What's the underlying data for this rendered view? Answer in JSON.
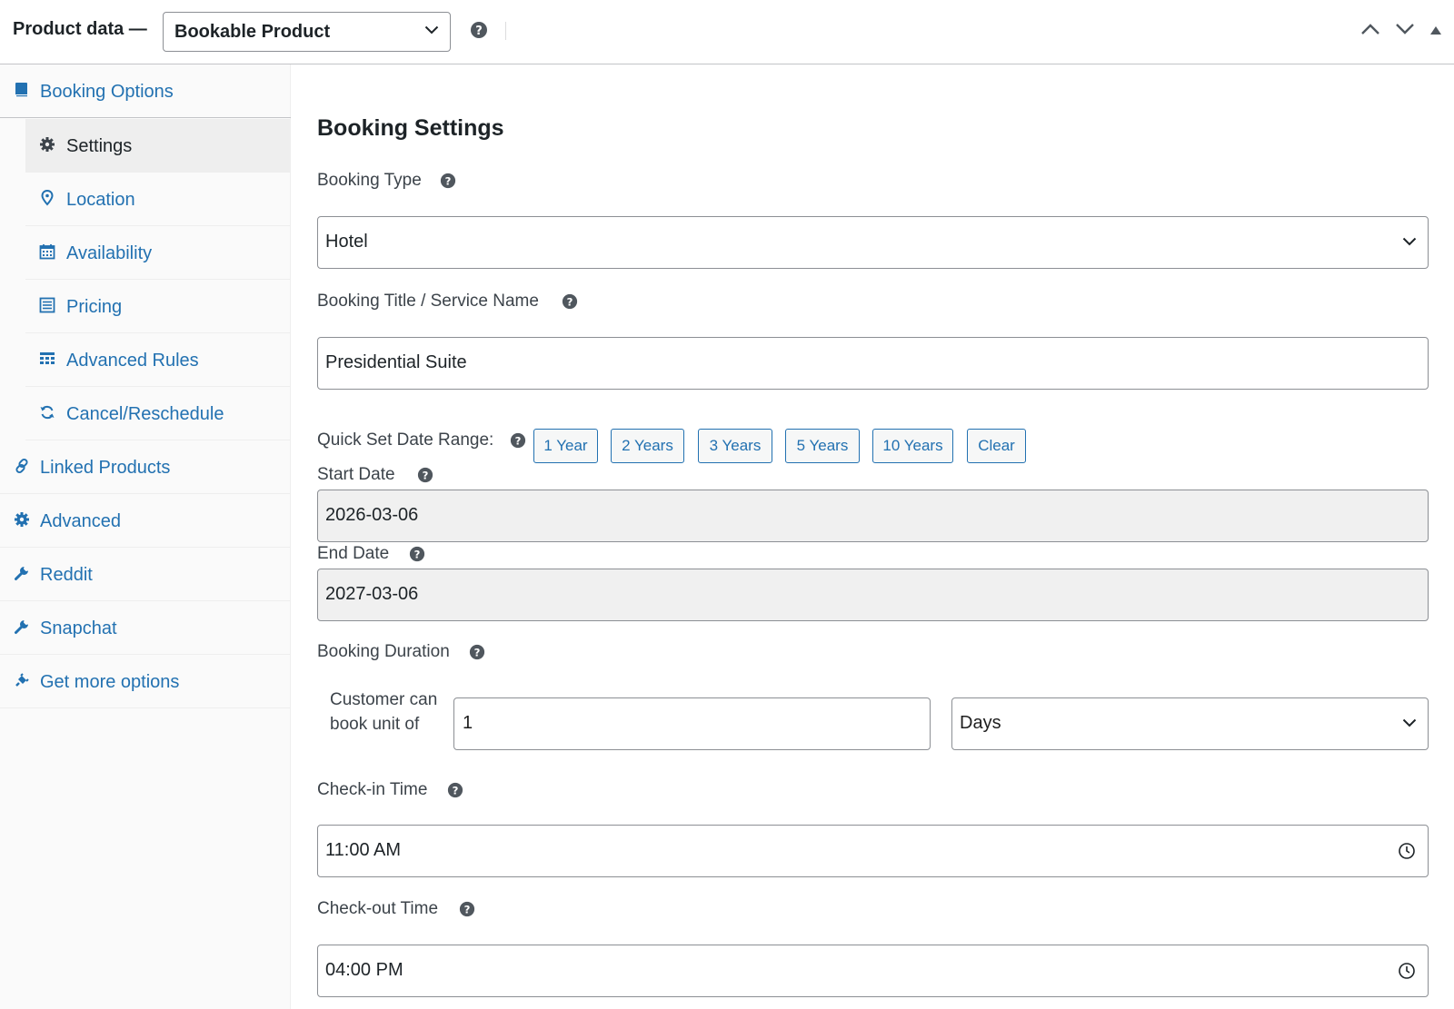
{
  "header": {
    "title": "Product data —",
    "product_type": "Bookable Product"
  },
  "sidebar": {
    "items": [
      {
        "label": "Booking Options",
        "icon": "book-icon"
      },
      {
        "label": "Settings",
        "icon": "gear-icon",
        "active": true
      },
      {
        "label": "Location",
        "icon": "location-pin-icon"
      },
      {
        "label": "Availability",
        "icon": "calendar-icon"
      },
      {
        "label": "Pricing",
        "icon": "list-icon"
      },
      {
        "label": "Advanced Rules",
        "icon": "table-icon"
      },
      {
        "label": "Cancel/Reschedule",
        "icon": "refresh-icon"
      },
      {
        "label": "Linked Products",
        "icon": "link-icon"
      },
      {
        "label": "Advanced",
        "icon": "gear-icon"
      },
      {
        "label": "Reddit",
        "icon": "wrench-icon"
      },
      {
        "label": "Snapchat",
        "icon": "wrench-icon"
      },
      {
        "label": "Get more options",
        "icon": "plugin-icon"
      }
    ]
  },
  "main": {
    "section_title": "Booking Settings",
    "booking_type": {
      "label": "Booking Type",
      "value": "Hotel"
    },
    "booking_title": {
      "label": "Booking Title / Service Name",
      "value": "Presidential Suite"
    },
    "quick_set": {
      "label": "Quick Set Date Range:",
      "buttons": [
        "1 Year",
        "2 Years",
        "3 Years",
        "5 Years",
        "10 Years",
        "Clear"
      ]
    },
    "start_date": {
      "label": "Start Date",
      "value": "2026-03-06"
    },
    "end_date": {
      "label": "End Date",
      "value": "2027-03-06"
    },
    "duration": {
      "label": "Booking Duration",
      "unit_label": "Customer can book unit of",
      "value": "1",
      "unit": "Days"
    },
    "checkin": {
      "label": "Check-in Time",
      "value": "11:00  AM"
    },
    "checkout": {
      "label": "Check-out Time",
      "value": "04:00  PM"
    }
  },
  "colors": {
    "link": "#2271b1",
    "border": "#8c8f94",
    "readonly_bg": "#f0f0f0",
    "active_bg": "#eeeeee"
  }
}
